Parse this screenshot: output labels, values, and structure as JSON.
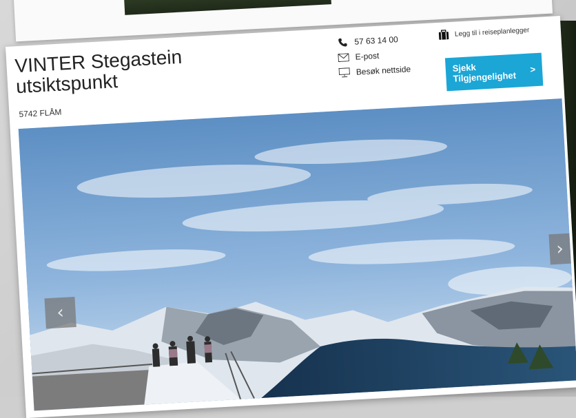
{
  "listing": {
    "title_line1": "VINTER Stegastein",
    "title_line2": "utsiktspunkt",
    "address": "5742 FLÅM"
  },
  "contact": {
    "phone": "57 63 14 00",
    "email_label": "E-post",
    "website_label": "Besøk nettside"
  },
  "trip_planner": {
    "label": "Legg til i reiseplanlegger"
  },
  "cta": {
    "line1": "Sjekk",
    "line2": "Tilgjengelighet",
    "arrow": ">"
  },
  "gallery": {
    "prev": "‹",
    "next": "›"
  },
  "colors": {
    "accent": "#1ba6d6",
    "text": "#222222"
  },
  "icons": [
    "phone-icon",
    "envelope-icon",
    "monitor-icon",
    "suitcase-icon"
  ]
}
